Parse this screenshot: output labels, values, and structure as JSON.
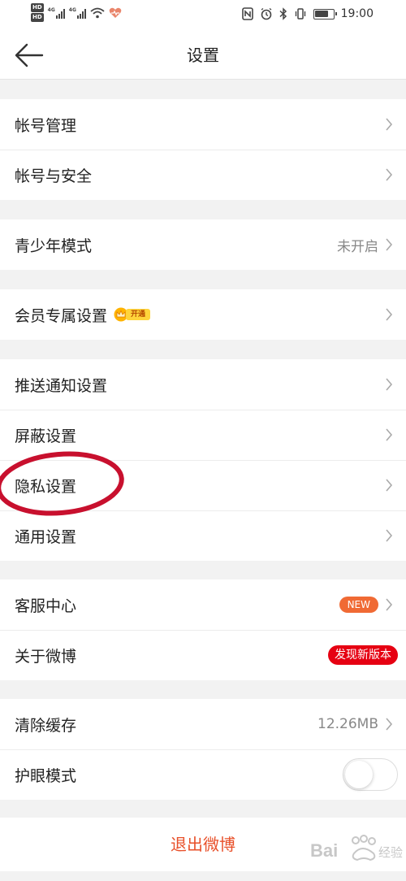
{
  "status_bar": {
    "hd_top": "HD",
    "hd_bottom": "HD",
    "net_1": "4G",
    "net_2": "4G",
    "time": "19:00",
    "icons": [
      "signal-icon",
      "wifi-icon",
      "health-icon",
      "nfc-icon",
      "alarm-icon",
      "bluetooth-icon",
      "vibrate-icon",
      "battery-icon"
    ]
  },
  "nav": {
    "title": "设置",
    "back_icon": "arrow-left-icon"
  },
  "groups": {
    "account": [
      {
        "label": "帐号管理"
      },
      {
        "label": "帐号与安全"
      }
    ],
    "youth": {
      "label": "青少年模式",
      "value": "未开启"
    },
    "vip": {
      "label": "会员专属设置",
      "badge": "开通"
    },
    "settings": [
      {
        "label": "推送通知设置"
      },
      {
        "label": "屏蔽设置"
      },
      {
        "label": "隐私设置"
      },
      {
        "label": "通用设置"
      }
    ],
    "service": {
      "label": "客服中心",
      "badge": "NEW"
    },
    "about": {
      "label": "关于微博",
      "badge": "发现新版本"
    },
    "cache": {
      "label": "清除缓存",
      "value": "12.26MB"
    },
    "eye": {
      "label": "护眼模式",
      "toggle_on": false
    }
  },
  "logout": {
    "label": "退出微博"
  },
  "colors": {
    "accent": "#e8502a",
    "new_badge": "#f06a34",
    "update_badge": "#e60012",
    "annotation": "#c8102e"
  },
  "watermark": {
    "text": "Baidu 经验"
  }
}
